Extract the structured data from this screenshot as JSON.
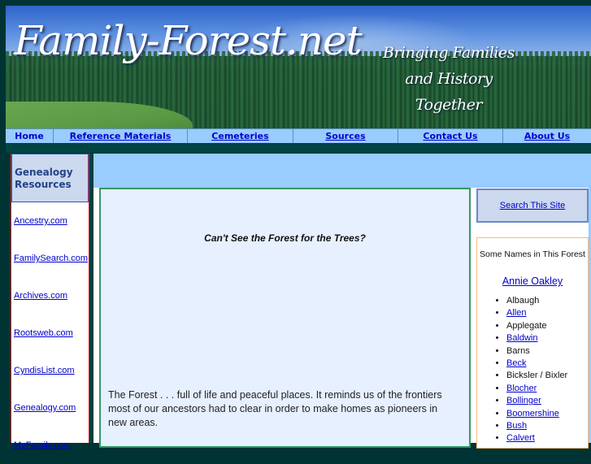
{
  "header": {
    "site_title": "Family-Forest.net",
    "tagline": [
      "Bringing Families",
      "and History",
      "Together"
    ]
  },
  "nav": {
    "items": [
      {
        "label": "Home"
      },
      {
        "label": "Reference Materials"
      },
      {
        "label": "Cemeteries"
      },
      {
        "label": "Sources"
      },
      {
        "label": "Contact Us"
      },
      {
        "label": "About Us"
      }
    ]
  },
  "sidebar": {
    "heading": "Genealogy Resources",
    "links": [
      {
        "label": "Ancestry.com"
      },
      {
        "label": "FamilySearch.com"
      },
      {
        "label": "Archives.com"
      },
      {
        "label": "Rootsweb.com"
      },
      {
        "label": "CyndisList.com"
      },
      {
        "label": "Genealogy.com"
      },
      {
        "label": "MyFamily.com"
      }
    ]
  },
  "main": {
    "title": "Can't See the Forest for the Trees?",
    "body": "The Forest . . . full of life and peaceful places. It reminds us of the frontiers most of our ancestors had to clear in order to make homes as pioneers in new areas."
  },
  "right": {
    "search_label": "Search This Site",
    "names_title": "Some Names in This Forest",
    "featured_name": "Annie Oakley",
    "names": [
      {
        "label": "Albaugh",
        "link": false
      },
      {
        "label": "Allen",
        "link": true
      },
      {
        "label": "Applegate",
        "link": false
      },
      {
        "label": "Baldwin",
        "link": true
      },
      {
        "label": "Barns",
        "link": false
      },
      {
        "label": "Beck",
        "link": true
      },
      {
        "label": "Bicksler / Bixler",
        "link": false
      },
      {
        "label": "Blocher",
        "link": true
      },
      {
        "label": "Bollinger",
        "link": true
      },
      {
        "label": "Boomershine",
        "link": true
      },
      {
        "label": "Bush",
        "link": true
      },
      {
        "label": "Calvert",
        "link": true
      }
    ]
  }
}
